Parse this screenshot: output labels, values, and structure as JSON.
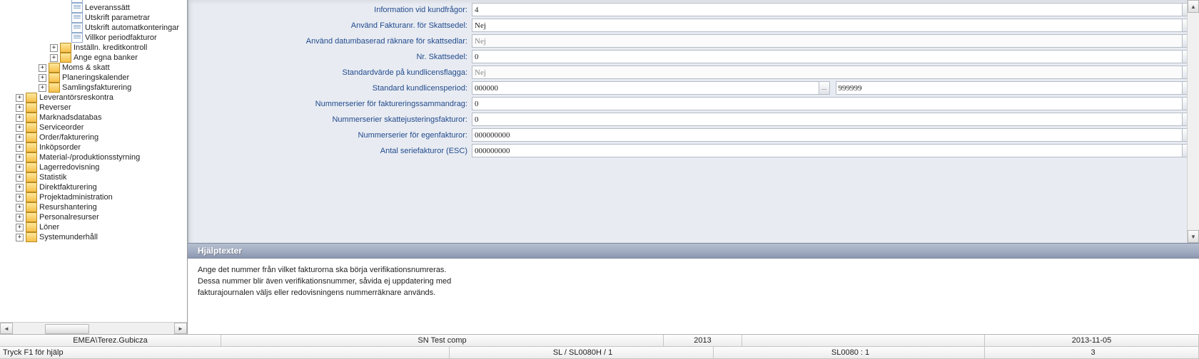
{
  "tree": {
    "l5": [
      {
        "label": "Leveranssätt",
        "icon": "page"
      },
      {
        "label": "Utskrift parametrar",
        "icon": "page"
      },
      {
        "label": "Utskrift automatkonteringar",
        "icon": "page"
      },
      {
        "label": "Villkor periodfakturor",
        "icon": "page"
      }
    ],
    "l4": [
      {
        "label": "Inställn. kreditkontroll",
        "icon": "folder",
        "exp": "plus"
      },
      {
        "label": "Ange egna banker",
        "icon": "folder",
        "exp": "plus"
      }
    ],
    "l3": [
      {
        "label": "Moms & skatt",
        "icon": "folder",
        "exp": "plus"
      },
      {
        "label": "Planeringskalender",
        "icon": "folder",
        "exp": "plus"
      },
      {
        "label": "Samlingsfakturering",
        "icon": "folder",
        "exp": "plus"
      }
    ],
    "l1": [
      {
        "label": "Leverantörsreskontra",
        "icon": "folder",
        "exp": "plus"
      },
      {
        "label": "Reverser",
        "icon": "folder",
        "exp": "plus"
      },
      {
        "label": "Marknadsdatabas",
        "icon": "folder",
        "exp": "plus"
      },
      {
        "label": "Serviceorder",
        "icon": "folder",
        "exp": "plus"
      },
      {
        "label": "Order/fakturering",
        "icon": "folder",
        "exp": "plus"
      },
      {
        "label": "Inköpsorder",
        "icon": "folder",
        "exp": "plus"
      },
      {
        "label": "Material-/produktionsstyrning",
        "icon": "folder",
        "exp": "plus"
      },
      {
        "label": "Lagerredovisning",
        "icon": "folder",
        "exp": "plus"
      },
      {
        "label": "Statistik",
        "icon": "folder",
        "exp": "plus"
      },
      {
        "label": "Direktfakturering",
        "icon": "folder",
        "exp": "plus"
      },
      {
        "label": "Projektadministration",
        "icon": "folder",
        "exp": "plus"
      },
      {
        "label": "Resurshantering",
        "icon": "folder",
        "exp": "plus"
      },
      {
        "label": "Personalresurser",
        "icon": "folder",
        "exp": "plus"
      },
      {
        "label": "Löner",
        "icon": "folder",
        "exp": "plus"
      },
      {
        "label": "Systemunderhåll",
        "icon": "folder",
        "exp": "plus"
      }
    ]
  },
  "form": [
    {
      "label": "Information vid kundfrågor",
      "value": "4",
      "type": "input"
    },
    {
      "label": "Använd Fakturanr. för Skattsedel",
      "value": "Nej",
      "type": "select"
    },
    {
      "label": "Använd datumbaserad räknare för skattsedlar",
      "value": "Nej",
      "type": "select",
      "disabled": true
    },
    {
      "label": "Nr. Skattsedel",
      "value": "0",
      "type": "input"
    },
    {
      "label": "Standardvärde på kundlicensflagga",
      "value": "Nej",
      "type": "select",
      "disabled": true
    },
    {
      "label": "Standard kundlicensperiod",
      "value": "000000",
      "type": "lookup",
      "value2": "999999"
    },
    {
      "label": "Nummerserier för faktureringssammandrag",
      "value": "0",
      "type": "input"
    },
    {
      "label": "Nummerserier skattejusteringsfakturor",
      "value": "0",
      "type": "input"
    },
    {
      "label": "Nummerserier för egenfakturor",
      "value": "000000000",
      "type": "input"
    },
    {
      "label": "Antal seriefakturor (ESC)",
      "value": "000000000",
      "type": "input",
      "nocolon": true
    }
  ],
  "help": {
    "title": "Hjälptexter",
    "line1": "Ange det nummer från vilket fakturorna ska börja verifikationsnumreras.",
    "line2": "Dessa nummer blir även verifikationsnummer, såvida ej uppdatering med",
    "line3": "fakturajournalen väljs eller redovisningens nummerräknare används."
  },
  "status": {
    "user": "EMEA\\Terez.Gubicza",
    "company": "SN Test comp",
    "year": "2013",
    "blank": "",
    "date": "2013-11-05",
    "hint": "Tryck F1 för hjälp",
    "screen": "SL / SL0080H / 1",
    "session": "SL0080 : 1",
    "line": "3"
  }
}
